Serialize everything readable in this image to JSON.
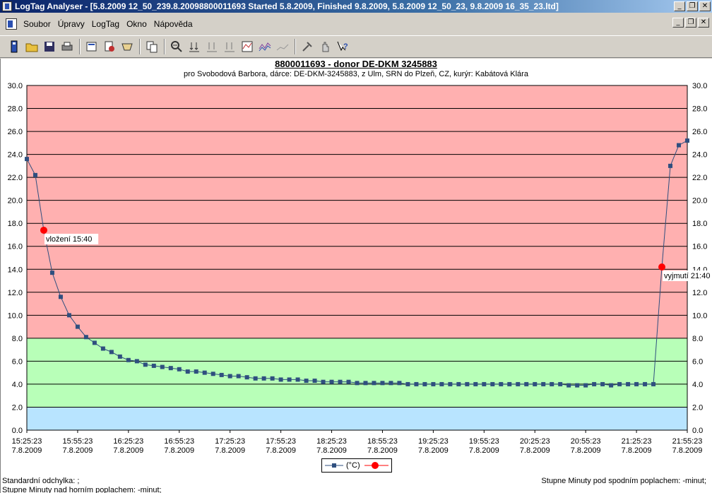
{
  "window": {
    "title": "LogTag Analyser - [5.8.2009 12_50_239.8.20098800011693 Started 5.8.2009, Finished 9.8.2009, 5.8.2009 12_50_23, 9.8.2009 16_35_23.ltd]",
    "minimize": "_",
    "restore": "❐",
    "close": "✕"
  },
  "menu": {
    "items": [
      "Soubor",
      "Úpravy",
      "LogTag",
      "Okno",
      "Nápověda"
    ]
  },
  "toolbar": {
    "buttons": [
      "new-logtag",
      "open",
      "save",
      "print",
      "properties",
      "download",
      "read",
      "copy",
      "zoom-out",
      "zoom-y",
      "zoom-fit",
      "zoom-reset",
      "threshold",
      "overlay",
      "chart-mode",
      "tools",
      "hand",
      "help"
    ]
  },
  "chart": {
    "title": "8800011693 - donor DE-DKM 3245883",
    "subtitle": "pro Svobodová Barbora, dárce: DE-DKM-3245883, z Ulm, SRN do Plzeň, CZ, kurýr: Kabátová Klára",
    "legend_label": "(°C)",
    "footer_std": "Standardní odchylka: ;",
    "footer_upper": "Stupne Minuty nad horním poplachem: -minut;",
    "footer_lower": "Stupne Minuty pod spodním poplachem: -minut;"
  },
  "chart_data": {
    "type": "line",
    "ylim": [
      0,
      30
    ],
    "yticks": [
      "0.0",
      "2.0",
      "4.0",
      "6.0",
      "8.0",
      "10.0",
      "12.0",
      "14.0",
      "16.0",
      "18.0",
      "20.0",
      "22.0",
      "24.0",
      "26.0",
      "28.0",
      "30.0"
    ],
    "xlabels": [
      [
        "15:25:23",
        "7.8.2009"
      ],
      [
        "15:55:23",
        "7.8.2009"
      ],
      [
        "16:25:23",
        "7.8.2009"
      ],
      [
        "16:55:23",
        "7.8.2009"
      ],
      [
        "17:25:23",
        "7.8.2009"
      ],
      [
        "17:55:23",
        "7.8.2009"
      ],
      [
        "18:25:23",
        "7.8.2009"
      ],
      [
        "18:55:23",
        "7.8.2009"
      ],
      [
        "19:25:23",
        "7.8.2009"
      ],
      [
        "19:55:23",
        "7.8.2009"
      ],
      [
        "20:25:23",
        "7.8.2009"
      ],
      [
        "20:55:23",
        "7.8.2009"
      ],
      [
        "21:25:23",
        "7.8.2009"
      ],
      [
        "21:55:23",
        "7.8.2009"
      ]
    ],
    "bands": [
      {
        "from": 8,
        "to": 30,
        "color": "#ffb0b0"
      },
      {
        "from": 2,
        "to": 8,
        "color": "#b8ffb8"
      },
      {
        "from": 0,
        "to": 2,
        "color": "#b8e4ff"
      }
    ],
    "series": [
      {
        "name": "(°C)",
        "color": "#2f4f7f",
        "values": [
          23.6,
          22.2,
          17.4,
          13.7,
          11.6,
          10.0,
          9.0,
          8.1,
          7.6,
          7.1,
          6.8,
          6.4,
          6.1,
          6.0,
          5.7,
          5.6,
          5.5,
          5.4,
          5.3,
          5.1,
          5.1,
          5.0,
          4.9,
          4.8,
          4.7,
          4.7,
          4.6,
          4.5,
          4.5,
          4.5,
          4.4,
          4.4,
          4.4,
          4.3,
          4.3,
          4.2,
          4.2,
          4.2,
          4.2,
          4.1,
          4.1,
          4.1,
          4.1,
          4.1,
          4.1,
          4.0,
          4.0,
          4.0,
          4.0,
          4.0,
          4.0,
          4.0,
          4.0,
          4.0,
          4.0,
          4.0,
          4.0,
          4.0,
          4.0,
          4.0,
          4.0,
          4.0,
          4.0,
          4.0,
          3.9,
          3.9,
          3.9,
          4.0,
          4.0,
          3.9,
          4.0,
          4.0,
          4.0,
          4.0,
          4.0,
          14.2,
          23.0,
          24.8,
          25.2
        ]
      }
    ],
    "events": [
      {
        "label": "vložení 15:40",
        "index": 2,
        "value": 17.4,
        "color": "#ff0000"
      },
      {
        "label": "vyjmutí 21:40",
        "index": 75,
        "value": 14.2,
        "color": "#ff0000"
      }
    ]
  }
}
